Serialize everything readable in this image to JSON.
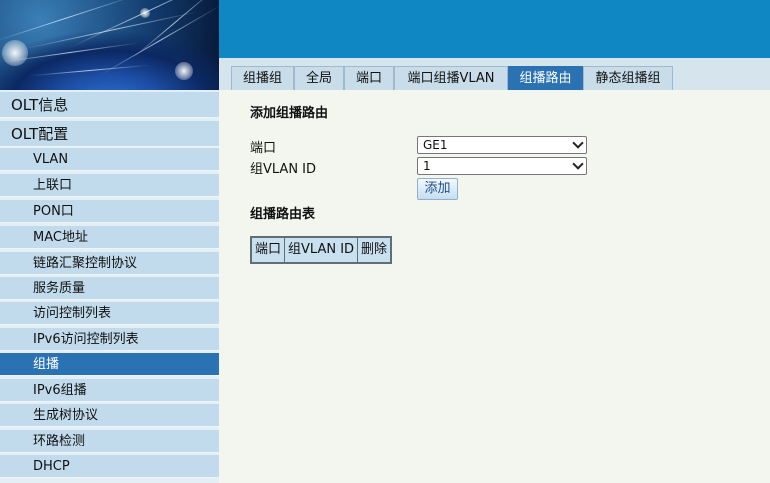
{
  "tabs": [
    {
      "label": "组播组"
    },
    {
      "label": "全局"
    },
    {
      "label": "端口"
    },
    {
      "label": "端口组播VLAN"
    },
    {
      "label": "组播路由"
    },
    {
      "label": "静态组播组"
    }
  ],
  "active_tab": "组播路由",
  "sidebar": {
    "items": [
      {
        "label": "OLT信息"
      },
      {
        "label": "OLT配置"
      },
      {
        "label": "VLAN"
      },
      {
        "label": "上联口"
      },
      {
        "label": "PON口"
      },
      {
        "label": "MAC地址"
      },
      {
        "label": "链路汇聚控制协议"
      },
      {
        "label": "服务质量"
      },
      {
        "label": "访问控制列表"
      },
      {
        "label": "IPv6访问控制列表"
      },
      {
        "label": "组播"
      },
      {
        "label": "IPv6组播"
      },
      {
        "label": "生成树协议"
      },
      {
        "label": "环路检测"
      },
      {
        "label": "DHCP"
      }
    ],
    "active_item": "组播"
  },
  "main": {
    "add_heading": "添加组播路由",
    "port_label": "端口",
    "port_value": "GE1",
    "vlan_label": "组VLAN ID",
    "vlan_value": "1",
    "add_button": "添加",
    "table_heading": "组播路由表",
    "table_columns": [
      "端口",
      "组VLAN ID",
      "删除"
    ]
  },
  "colors": {
    "topbar": "#0e87c3",
    "active": "#2b72b3",
    "sidebar_item": "#c2dbec",
    "content_bg": "#f3f6ef"
  }
}
